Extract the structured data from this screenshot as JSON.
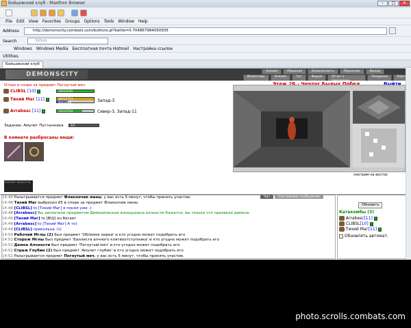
{
  "window": {
    "title": "Бойцовский клуб - Maxthon Browser"
  },
  "menu": [
    "File",
    "Edit",
    "View",
    "Favorites",
    "Groups",
    "Options",
    "Tools",
    "Window",
    "Help"
  ],
  "address": {
    "label": "Address",
    "value": "http://demonscity.combats.com/buttons.pl?battle=0.704867984050935"
  },
  "search": {
    "label": "Search",
    "placeholder": "Yahoo"
  },
  "links": [
    "Windows",
    "Windows Media",
    "Бесплатная почта Hotmail",
    "Настройка ссылок"
  ],
  "utilities": {
    "label": "Utilities"
  },
  "tab": {
    "label": "Бойцовский клуб"
  },
  "game": {
    "logo": "DEMONSCITY",
    "nav_top": [
      "Знания",
      "Общение",
      "Безопасность",
      "Персонаж",
      "Выход"
    ],
    "nav_bottom": [
      "Инвентарь",
      "Умения",
      "Чат",
      "Форум",
      "Отчет о персонаже",
      "Поединки",
      "Карта"
    ],
    "notice": "Отказ в споре за предмет Погнутый меч",
    "players": [
      {
        "name": "CLIBSL",
        "level": "[10]",
        "hp": "2065/2065",
        "mp": "",
        "pos": ""
      },
      {
        "name": "Тихий Маг",
        "level": "[11]",
        "hp": "1811/1714",
        "mp": "804/2648",
        "pos": "Запад-3"
      },
      {
        "name": "Arrabesc",
        "level": "[11]",
        "hp": "1541/2244",
        "mp": "",
        "pos": "Север-3, Запад-11"
      }
    ],
    "task": "Задание: Амулет Пустынника",
    "task_progress": "0/3",
    "items_title": "В комнате разбросаны вещи:",
    "location": "Этаж 2Б - Чертог Былых Побед",
    "exit": "Выйти",
    "facing": "смотрим на восток",
    "counter_box": "РЕЙТИНГ ВЕБЛОГОВ"
  },
  "chat": {
    "tabs": [
      "Чат",
      "Системные сообщения"
    ],
    "lines": [
      {
        "ts": "14:48",
        "who": "",
        "text": "Разыгрывается предмет ",
        "bold": "Флакончик маны",
        "rest": ", у вас есть 5 минут, чтобы принять участие."
      },
      {
        "ts": "14:48",
        "who": "Тихий Маг",
        "text": " выбросил 65 в споре за предмет Флакончик маны",
        "bold": "",
        "rest": ""
      },
      {
        "ts": "14:48",
        "who": "[CLIBSL]",
        "text": " to [Тихий Маг] я понял уже :)",
        "bold": "",
        "rest": ""
      },
      {
        "ts": "14:48",
        "who": "[Arrabesc]",
        "text": " Вы заплатили предметом Демоническая женщуажна алчности Кажется, вы только что призвали демона.",
        "bold": "",
        "rest": ""
      },
      {
        "ts": "14:49",
        "who": "[Тихий Маг]",
        "text": " to [BUJ] он бегает",
        "bold": "",
        "rest": ""
      },
      {
        "ts": "14:49",
        "who": "[Arrabesc]",
        "text": " to [Тихий Маг] А то)",
        "bold": "",
        "rest": ""
      },
      {
        "ts": "14:49",
        "who": "[CLIBSL]",
        "text": " прикольна :)))",
        "bold": "",
        "rest": ""
      },
      {
        "ts": "14:50",
        "who": "",
        "text": "",
        "bold": "Рабочий Мглы (2)",
        "rest": " был предмет 'Обломок кирки' и кто угодно может подобрать его"
      },
      {
        "ts": "14:52",
        "who": "",
        "text": "",
        "bold": "Сторож Мглы",
        "rest": " был предмет 'Баллиста алчного клятвоотступника' и кто угодно может подобрать его"
      },
      {
        "ts": "14:52",
        "who": "",
        "text": "",
        "bold": "Демон Алчности",
        "rest": " был предмет 'Погнутый меч' и кто угодно может подобрать его"
      },
      {
        "ts": "14:52",
        "who": "",
        "text": "",
        "bold": "Страж Глубин (2)",
        "rest": " был предмет 'Амулет глубин' и кто угодно может подобрать его"
      },
      {
        "ts": "14:52",
        "who": "",
        "text": "Разыгрывается предмет ",
        "bold": "Погнутый меч",
        "rest": ", у вас есть 5 минут, чтобы принять участие."
      }
    ]
  },
  "side": {
    "refresh": "Обновить",
    "title": "Катакомбы (3)",
    "members": [
      {
        "name": "Arrabesc",
        "level": "[11]"
      },
      {
        "name": "CLIBSL",
        "level": "[10]"
      },
      {
        "name": "Тихий Маг",
        "level": "[11]"
      }
    ],
    "auto": "Обновлять автомат."
  },
  "watermark": "photo.scrolls.combats.com"
}
